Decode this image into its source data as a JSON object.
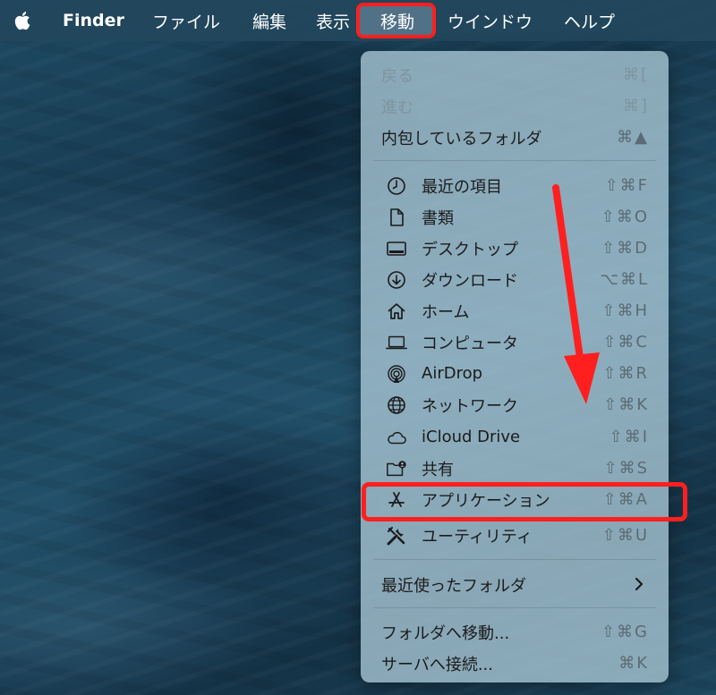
{
  "menubar": {
    "items": [
      "Finder",
      "ファイル",
      "編集",
      "表示",
      "移動",
      "ウインドウ",
      "ヘルプ"
    ]
  },
  "menu": {
    "top_items": [
      {
        "label": "戻る",
        "shortcut": "⌘[",
        "disabled": true
      },
      {
        "label": "進む",
        "shortcut": "⌘]",
        "disabled": true
      },
      {
        "label": "内包しているフォルダ",
        "shortcut": "⌘▲",
        "disabled": false
      }
    ],
    "places": [
      {
        "label": "最近の項目",
        "shortcut": "⇧⌘F",
        "icon": "clock-icon"
      },
      {
        "label": "書類",
        "shortcut": "⇧⌘O",
        "icon": "document-icon"
      },
      {
        "label": "デスクトップ",
        "shortcut": "⇧⌘D",
        "icon": "desktop-icon"
      },
      {
        "label": "ダウンロード",
        "shortcut": "⌥⌘L",
        "icon": "download-icon"
      },
      {
        "label": "ホーム",
        "shortcut": "⇧⌘H",
        "icon": "home-icon"
      },
      {
        "label": "コンピュータ",
        "shortcut": "⇧⌘C",
        "icon": "laptop-icon"
      },
      {
        "label": "AirDrop",
        "shortcut": "⇧⌘R",
        "icon": "airdrop-icon"
      },
      {
        "label": "ネットワーク",
        "shortcut": "⇧⌘K",
        "icon": "globe-icon"
      },
      {
        "label": "iCloud Drive",
        "shortcut": "⇧⌘I",
        "icon": "cloud-icon"
      },
      {
        "label": "共有",
        "shortcut": "⇧⌘S",
        "icon": "shared-folder-icon"
      },
      {
        "label": "アプリケーション",
        "shortcut": "⇧⌘A",
        "icon": "applications-icon"
      },
      {
        "label": "ユーティリティ",
        "shortcut": "⇧⌘U",
        "icon": "utilities-icon"
      }
    ],
    "recent_folders": {
      "label": "最近使ったフォルダ"
    },
    "bottom_items": [
      {
        "label": "フォルダへ移動...",
        "shortcut": "⇧⌘G"
      },
      {
        "label": "サーバへ接続...",
        "shortcut": "⌘K"
      }
    ]
  },
  "colors": {
    "annotation": "#ff1f1f",
    "menubar": "#23465c",
    "menu_bg": "#aac8d6"
  }
}
